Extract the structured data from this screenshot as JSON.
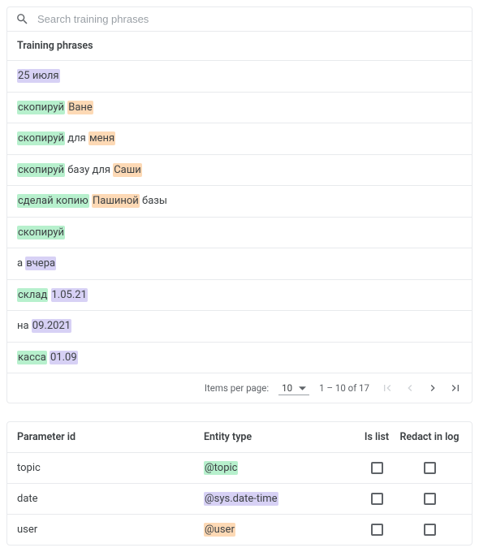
{
  "search": {
    "placeholder": "Search training phrases"
  },
  "trainingSection": {
    "header": "Training phrases",
    "phrases": [
      {
        "parts": [
          {
            "text": "25 июля",
            "cls": "tok-purple"
          }
        ]
      },
      {
        "parts": [
          {
            "text": "скопируй",
            "cls": "tok-green"
          },
          {
            "text": " ",
            "cls": ""
          },
          {
            "text": "Ване",
            "cls": "tok-orange"
          }
        ]
      },
      {
        "parts": [
          {
            "text": "скопируй",
            "cls": "tok-green"
          },
          {
            "text": " для ",
            "cls": ""
          },
          {
            "text": "меня",
            "cls": "tok-orange"
          }
        ]
      },
      {
        "parts": [
          {
            "text": "скопируй",
            "cls": "tok-green"
          },
          {
            "text": " базу для ",
            "cls": ""
          },
          {
            "text": "Саши",
            "cls": "tok-orange"
          }
        ]
      },
      {
        "parts": [
          {
            "text": "сделай копию",
            "cls": "tok-green"
          },
          {
            "text": " ",
            "cls": ""
          },
          {
            "text": "Пашиной",
            "cls": "tok-orange"
          },
          {
            "text": " базы",
            "cls": ""
          }
        ]
      },
      {
        "parts": [
          {
            "text": "скопируй",
            "cls": "tok-green"
          }
        ]
      },
      {
        "parts": [
          {
            "text": "а ",
            "cls": ""
          },
          {
            "text": "вчера",
            "cls": "tok-purple"
          }
        ]
      },
      {
        "parts": [
          {
            "text": "склад",
            "cls": "tok-green"
          },
          {
            "text": " ",
            "cls": ""
          },
          {
            "text": "1.05.21",
            "cls": "tok-purple"
          }
        ]
      },
      {
        "parts": [
          {
            "text": "на ",
            "cls": ""
          },
          {
            "text": "09.2021",
            "cls": "tok-purple"
          }
        ]
      },
      {
        "parts": [
          {
            "text": "касса",
            "cls": "tok-green"
          },
          {
            "text": " ",
            "cls": ""
          },
          {
            "text": "01.09",
            "cls": "tok-purple"
          }
        ]
      }
    ]
  },
  "paginator": {
    "itemsPerPageLabel": "Items per page:",
    "pageSize": "10",
    "range": "1 – 10 of 17"
  },
  "paramsSection": {
    "headers": {
      "id": "Parameter id",
      "type": "Entity type",
      "list": "Is list",
      "redact": "Redact in log"
    },
    "rows": [
      {
        "id": "topic",
        "type": "@topic",
        "typeCls": "tok-green"
      },
      {
        "id": "date",
        "type": "@sys.date-time",
        "typeCls": "tok-purple"
      },
      {
        "id": "user",
        "type": "@user",
        "typeCls": "tok-orange"
      }
    ]
  }
}
